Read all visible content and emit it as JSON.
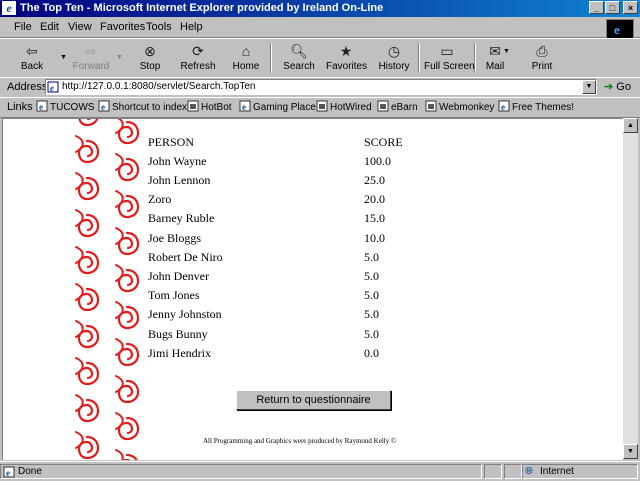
{
  "window": {
    "title": "The Top Ten - Microsoft Internet Explorer provided by Ireland On-Line",
    "controls": [
      "_",
      "□",
      "×"
    ]
  },
  "menu": [
    "File",
    "Edit",
    "View",
    "Favorites",
    "Tools",
    "Help"
  ],
  "toolbar": {
    "back": "Back",
    "forward": "Forward",
    "stop": "Stop",
    "refresh": "Refresh",
    "home": "Home",
    "search": "Search",
    "favorites": "Favorites",
    "history": "History",
    "fullscreen": "Full Screen",
    "mail": "Mail",
    "print": "Print"
  },
  "address": {
    "label": "Address",
    "url": "http://127.0.0.1:8080/servlet/Search.TopTen",
    "go": "Go"
  },
  "links": {
    "label": "Links",
    "items": [
      "TUCOWS",
      "Shortcut to index",
      "HotBot",
      "Gaming Place",
      "HotWired",
      "eBarn",
      "Webmonkey",
      "Free Themes!"
    ]
  },
  "table": {
    "headers": [
      "PERSON",
      "SCORE"
    ],
    "rows": [
      [
        "John Wayne",
        "100.0"
      ],
      [
        "John Lennon",
        "25.0"
      ],
      [
        "Zoro",
        "20.0"
      ],
      [
        "Barney Ruble",
        "15.0"
      ],
      [
        "Joe Bloggs",
        "10.0"
      ],
      [
        "Robert De Niro",
        "5.0"
      ],
      [
        "John Denver",
        "5.0"
      ],
      [
        "Tom Jones",
        "5.0"
      ],
      [
        "Jenny Johnston",
        "5.0"
      ],
      [
        "Bugs Bunny",
        "5.0"
      ],
      [
        "Jimi Hendrix",
        "0.0"
      ]
    ]
  },
  "return_button": "Return to questionnaire",
  "credit": "All Programming and Graphics were produced by Raymond Kelly ©",
  "status": {
    "text": "Done",
    "zone": "Internet"
  },
  "colors": {
    "titlebar": "#000080",
    "swirl": "#e00000"
  }
}
